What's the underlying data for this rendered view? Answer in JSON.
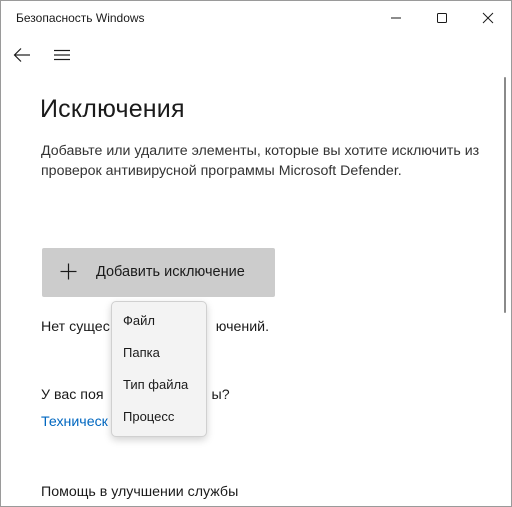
{
  "window": {
    "title": "Безопасность Windows"
  },
  "icons": {
    "minimize": "minimize-icon",
    "maximize": "maximize-icon",
    "close": "close-icon",
    "back": "back-arrow-icon",
    "menu": "hamburger-menu-icon",
    "add": "plus-icon"
  },
  "page": {
    "title": "Исключения",
    "description": "Добавьте или удалите элементы, которые вы хотите исключить из проверок антивирусной программы Microsoft Defender."
  },
  "add_button": {
    "label": "Добавить исключение"
  },
  "dropdown": {
    "items": [
      "Файл",
      "Папка",
      "Тип файла",
      "Процесс"
    ]
  },
  "body_text": {
    "no_exclusions": "Нет сущес",
    "no_exclusions_tail": "ючений.",
    "question": "У вас поя",
    "question_tail": "ы?",
    "link": "Техническ",
    "help_heading": "Помощь в улучшении службы"
  },
  "colors": {
    "accent_link": "#0067c0",
    "button_bg": "#cccccc",
    "menu_bg": "#f3f3f3"
  }
}
